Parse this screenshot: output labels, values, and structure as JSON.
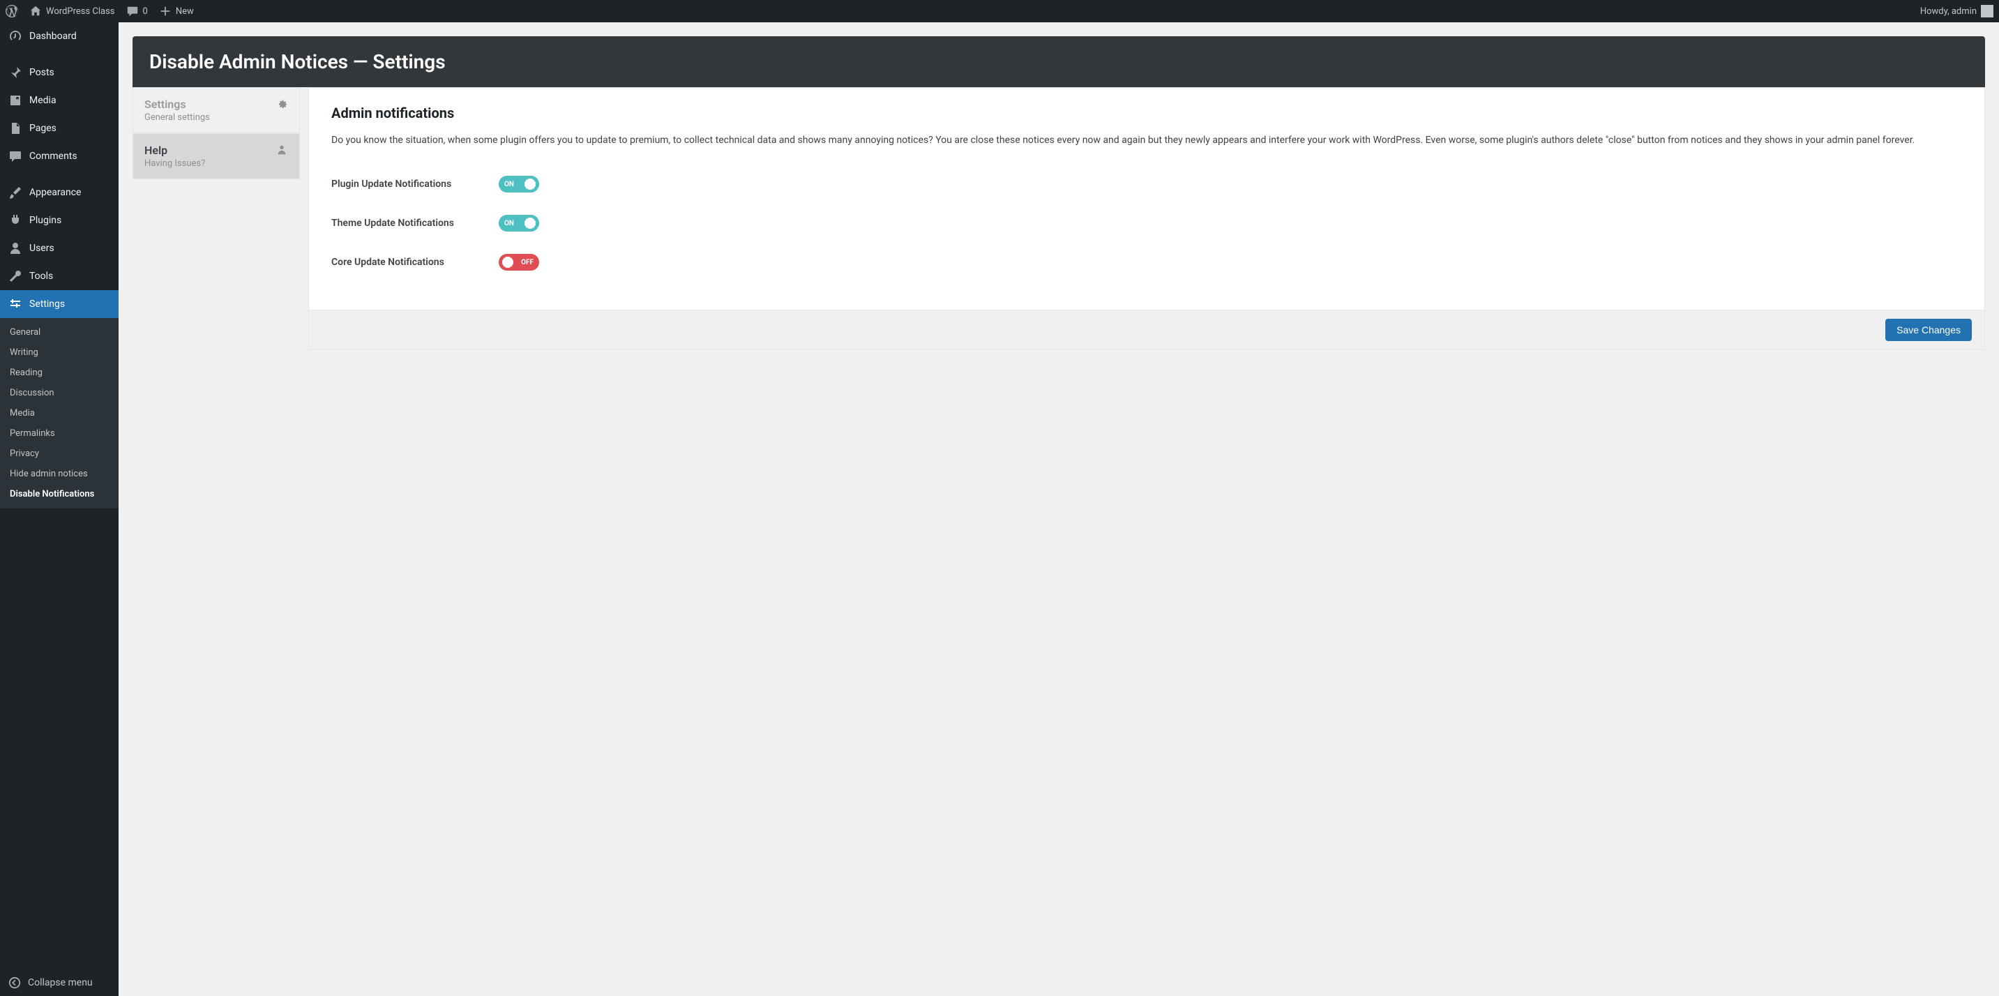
{
  "adminbar": {
    "site_name": "WordPress Class",
    "comments_count": "0",
    "new_label": "New",
    "howdy": "Howdy, admin"
  },
  "menu": {
    "dashboard": "Dashboard",
    "posts": "Posts",
    "media": "Media",
    "pages": "Pages",
    "comments": "Comments",
    "appearance": "Appearance",
    "plugins": "Plugins",
    "users": "Users",
    "tools": "Tools",
    "settings": "Settings",
    "collapse": "Collapse menu"
  },
  "submenu": {
    "general": "General",
    "writing": "Writing",
    "reading": "Reading",
    "discussion": "Discussion",
    "media": "Media",
    "permalinks": "Permalinks",
    "privacy": "Privacy",
    "hide_notices": "Hide admin notices",
    "disable_notifications": "Disable Notifications"
  },
  "page_title": "Disable Admin Notices — Settings",
  "tabs": {
    "settings": {
      "title": "Settings",
      "sub": "General settings"
    },
    "help": {
      "title": "Help",
      "sub": "Having Issues?"
    }
  },
  "panel": {
    "heading": "Admin notifications",
    "description": "Do you know the situation, when some plugin offers you to update to premium, to collect technical data and shows many annoying notices? You are close these notices every now and again but they newly appears and interfere your work with WordPress. Even worse, some plugin's authors delete \"close\" button from notices and they shows in your admin panel forever.",
    "settings": {
      "plugin_update": {
        "label": "Plugin Update Notifications",
        "state": "ON"
      },
      "theme_update": {
        "label": "Theme Update Notifications",
        "state": "ON"
      },
      "core_update": {
        "label": "Core Update Notifications",
        "state": "OFF"
      }
    },
    "save_button": "Save Changes"
  }
}
